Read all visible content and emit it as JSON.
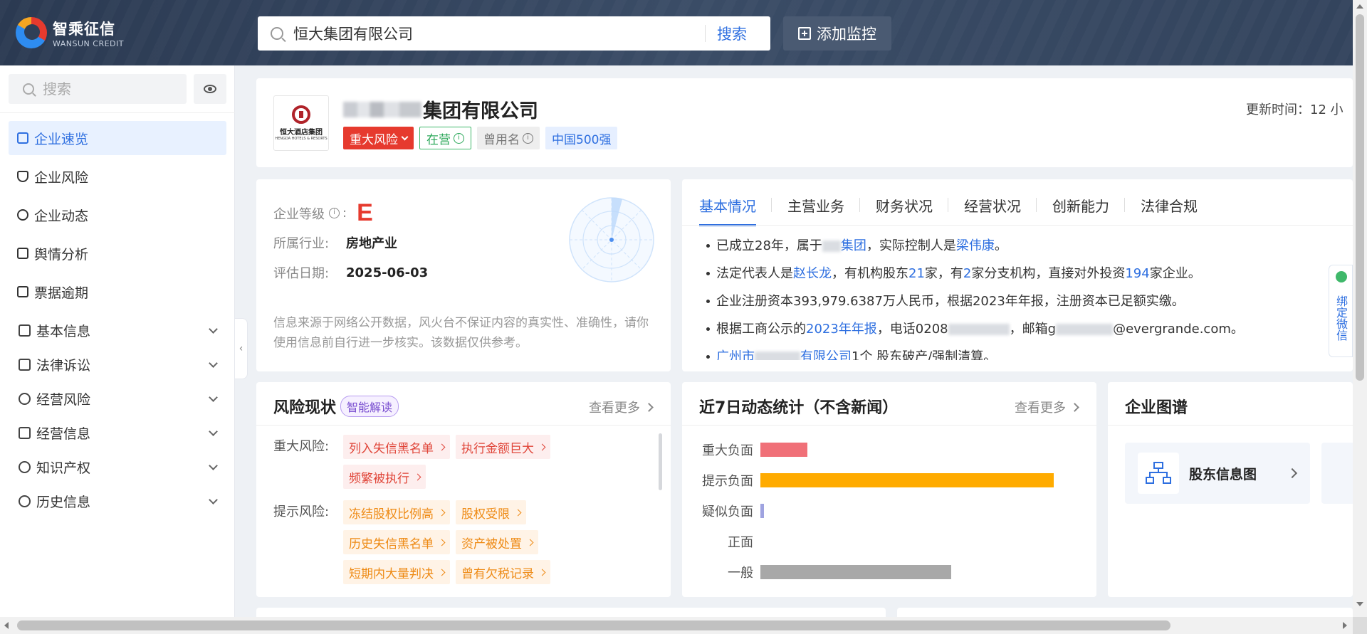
{
  "brand": {
    "name_cn": "智乘征信",
    "name_en": "WANSUN CREDIT"
  },
  "header": {
    "search_value": "恒大集团有限公司",
    "search_button": "搜索",
    "monitor_button": "添加监控"
  },
  "sidebar": {
    "search_placeholder": "搜索",
    "items": [
      {
        "label": "企业速览",
        "icon": "overview-icon"
      },
      {
        "label": "企业风险",
        "icon": "shield-icon"
      },
      {
        "label": "企业动态",
        "icon": "compass-icon"
      },
      {
        "label": "舆情分析",
        "icon": "document-icon"
      },
      {
        "label": "票据逾期",
        "icon": "ticket-icon"
      }
    ],
    "groups": [
      {
        "label": "基本信息",
        "icon": "info-doc-icon"
      },
      {
        "label": "法律诉讼",
        "icon": "law-icon"
      },
      {
        "label": "经营风险",
        "icon": "lightning-icon"
      },
      {
        "label": "经营信息",
        "icon": "chart-icon"
      },
      {
        "label": "知识产权",
        "icon": "copyright-icon"
      },
      {
        "label": "历史信息",
        "icon": "clock-icon"
      }
    ]
  },
  "company": {
    "logo_cn": "恒大酒店集团",
    "logo_en": "HENGDA HOTELS & RESORTS",
    "name_suffix": "集团有限公司",
    "tags": {
      "risk": "重大风险",
      "status": "在营",
      "alias": "曾用名",
      "rank": "中国500强"
    },
    "update_label": "更新时间：",
    "update_value": "12 小"
  },
  "grade": {
    "grade_label": "企业等级",
    "grade_value": "E",
    "industry_label": "所属行业:",
    "industry_value": "房地产业",
    "date_label": "评估日期:",
    "date_value": "2025-06-03",
    "note": "信息来源于网络公开数据，风火台不保证内容的真实性、准确性，请你使用信息前自行进一步核实。该数据仅供参考。"
  },
  "info": {
    "tabs": [
      "基本情况",
      "主营业务",
      "财务状况",
      "经营状况",
      "创新能力",
      "法律合规"
    ],
    "bullets": {
      "b1_pre": "已成立28年，属于",
      "b1_link1": "集团",
      "b1_mid": "，实际控制人是",
      "b1_link2": "梁伟康",
      "b1_end": "。",
      "b2_pre": "法定代表人是",
      "b2_link1": "赵长龙",
      "b2_mid1": "，有机构股东",
      "b2_link2": "21",
      "b2_mid2": "家，有",
      "b2_link3": "2",
      "b2_mid3": "家分支机构，直接对外投资",
      "b2_link4": "194",
      "b2_end": "家企业。",
      "b3": "企业注册资本393,979.6387万人民币，根据2023年年报，注册资本已足额实缴。",
      "b4_pre": "根据工商公示的",
      "b4_link": "2023年年报",
      "b4_mid": "，电话0208",
      "b4_mid2": "，邮箱g",
      "b4_end": "@evergrande.com。",
      "b5_link1": "广州市",
      "b5_link2": "有限公司",
      "b5_end": "1个 股东破产/强制清算。"
    }
  },
  "wechat": {
    "label": "绑定微信"
  },
  "risk": {
    "title": "风险现状",
    "ai_badge": "智能解读",
    "more": "查看更多",
    "major_label": "重大风险:",
    "major": [
      "列入失信黑名单",
      "执行金额巨大",
      "频繁被执行"
    ],
    "hint_label": "提示风险:",
    "hint": [
      "冻结股权比例高",
      "股权受限",
      "历史失信黑名单",
      "资产被处置",
      "短期内大量判决",
      "曾有欠税记录"
    ]
  },
  "stats": {
    "title": "近7日动态统计（不含新闻）",
    "more": "查看更多",
    "chart_data": {
      "type": "bar",
      "categories": [
        "重大负面",
        "提示负面",
        "疑似负面",
        "正面",
        "一般"
      ],
      "values": [
        0.16,
        1.0,
        0.012,
        0,
        0.65
      ],
      "colors": [
        "#f07078",
        "#ffab00",
        "#9fa3e0",
        "#cccccc",
        "#a8a8a8"
      ]
    }
  },
  "graph": {
    "title": "企业图谱",
    "items": [
      {
        "label": "股东信息图",
        "icon": "hierarchy-icon"
      }
    ]
  }
}
